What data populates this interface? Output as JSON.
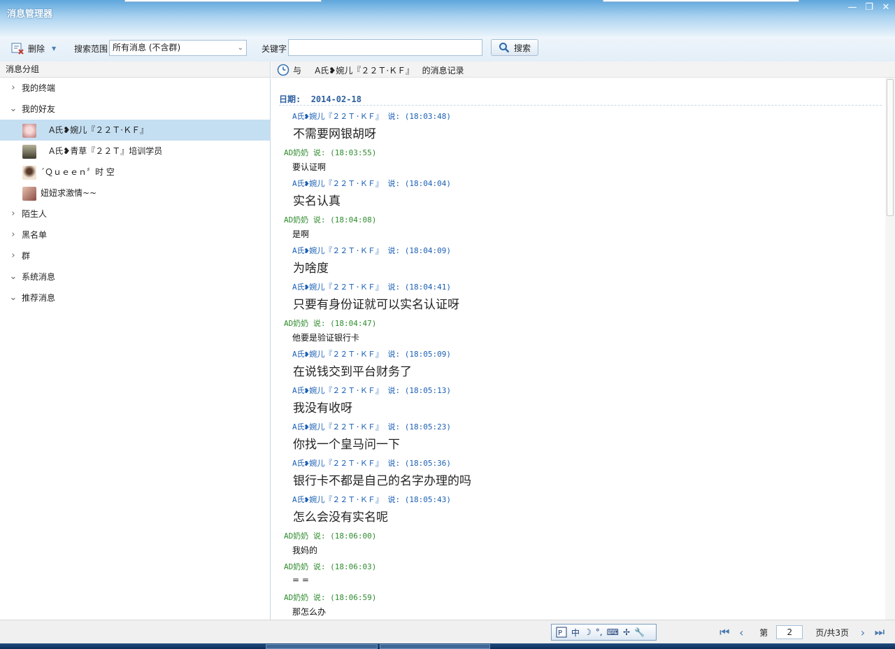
{
  "window": {
    "title": "消息管理器",
    "controls": {
      "minimize": "—",
      "maximize": "❐",
      "close": "✕"
    }
  },
  "toolbar": {
    "delete_label": "删除",
    "scope_label": "搜索范围",
    "scope_value": "所有消息 (不含群)",
    "keyword_label": "关键字",
    "keyword_value": "",
    "search_label": "搜索"
  },
  "sidebar": {
    "header": "消息分组",
    "items": [
      {
        "label": "我的终端",
        "chev": "›",
        "expanded": false
      },
      {
        "label": "我的好友",
        "chev": "⌄",
        "expanded": true
      },
      {
        "label": "A氏❥婉儿『２２Ｔ·ＫＦ』",
        "selected": true,
        "avatar": "#e8b7b7"
      },
      {
        "label": "A氏❥青草『２２Ｔ』培训学员",
        "avatar": "#6f6a55"
      },
      {
        "label": "ˊＱｕｅｅｎ〞时 空",
        "avatar": "#d9b89a"
      },
      {
        "label": "妞妞求激情~~",
        "avatar": "#c7847a"
      },
      {
        "label": "陌生人",
        "chev": "›",
        "expanded": false
      },
      {
        "label": "黑名单",
        "chev": "›",
        "expanded": false
      },
      {
        "label": "群",
        "chev": "›",
        "expanded": false
      },
      {
        "label": "系统消息",
        "chev": "⌄",
        "expanded": true
      },
      {
        "label": "推荐消息",
        "chev": "⌄",
        "expanded": true
      }
    ]
  },
  "conversation": {
    "header_prefix": "与",
    "header_name": "A氏❥婉儿『２２Ｔ·ＫＦ』",
    "header_suffix": "的消息记录",
    "date_label": "日期:",
    "date": "2014-02-18",
    "messages": [
      {
        "sender": "A氏❥婉儿『２２Ｔ·ＫＦ』",
        "says": "说:",
        "time": "(18:03:48)",
        "text": "不需要网银胡呀",
        "side": "them"
      },
      {
        "sender": "AD奶奶",
        "says": "说:",
        "time": "(18:03:55)",
        "text": "要认证啊",
        "side": "me"
      },
      {
        "sender": "A氏❥婉儿『２２Ｔ·ＫＦ』",
        "says": "说:",
        "time": "(18:04:04)",
        "text": "实名认真",
        "side": "them"
      },
      {
        "sender": "AD奶奶",
        "says": "说:",
        "time": "(18:04:08)",
        "text": "是啊",
        "side": "me"
      },
      {
        "sender": "A氏❥婉儿『２２Ｔ·ＫＦ』",
        "says": "说:",
        "time": "(18:04:09)",
        "text": "为啥度",
        "side": "them"
      },
      {
        "sender": "A氏❥婉儿『２２Ｔ·ＫＦ』",
        "says": "说:",
        "time": "(18:04:41)",
        "text": "只要有身份证就可以实名认证呀",
        "side": "them"
      },
      {
        "sender": "AD奶奶",
        "says": "说:",
        "time": "(18:04:47)",
        "text": "他要是验证银行卡",
        "side": "me"
      },
      {
        "sender": "A氏❥婉儿『２２Ｔ·ＫＦ』",
        "says": "说:",
        "time": "(18:05:09)",
        "text": "在说钱交到平台财务了",
        "side": "them"
      },
      {
        "sender": "A氏❥婉儿『２２Ｔ·ＫＦ』",
        "says": "说:",
        "time": "(18:05:13)",
        "text": "我没有收呀",
        "side": "them"
      },
      {
        "sender": "A氏❥婉儿『２２Ｔ·ＫＦ』",
        "says": "说:",
        "time": "(18:05:23)",
        "text": "你找一个皇马问一下",
        "side": "them"
      },
      {
        "sender": "A氏❥婉儿『２２Ｔ·ＫＦ』",
        "says": "说:",
        "time": "(18:05:36)",
        "text": "银行卡不都是自己的名字办理的吗",
        "side": "them"
      },
      {
        "sender": "A氏❥婉儿『２２Ｔ·ＫＦ』",
        "says": "说:",
        "time": "(18:05:43)",
        "text": "怎么会没有实名呢",
        "side": "them"
      },
      {
        "sender": "AD奶奶",
        "says": "说:",
        "time": "(18:06:00)",
        "text": "我妈的",
        "side": "me"
      },
      {
        "sender": "AD奶奶",
        "says": "说:",
        "time": "(18:06:03)",
        "text": "= =",
        "side": "me"
      },
      {
        "sender": "AD奶奶",
        "says": "说:",
        "time": "(18:06:59)",
        "text": "那怎么办",
        "side": "me"
      }
    ]
  },
  "ime": [
    "中",
    "☽",
    "°,",
    "⌨",
    "✢",
    "🔧"
  ],
  "pager": {
    "page_label": "第",
    "current": "2",
    "total_label": "页/共3页",
    "first": "⏮",
    "prev": "‹",
    "next": "›",
    "last": "⏭"
  },
  "colors": {
    "them": "#1a5fb4",
    "me": "#2e8b2e",
    "selected_row": "#c5dff2"
  }
}
